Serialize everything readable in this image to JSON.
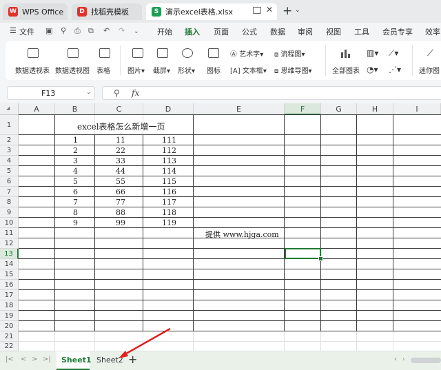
{
  "titlebar": {
    "tabs": [
      {
        "label": "WPS Office"
      },
      {
        "label": "找稻壳模板"
      },
      {
        "label": "演示excel表格.xlsx"
      }
    ]
  },
  "menu": {
    "file": "文件",
    "items": [
      "开始",
      "插入",
      "页面",
      "公式",
      "数据",
      "审阅",
      "视图",
      "工具",
      "会员专享",
      "效率"
    ],
    "active": "插入"
  },
  "ribbon": {
    "pivot_table": "数据透视表",
    "pivot_chart": "数据透视图",
    "table": "表格",
    "picture": "图片",
    "screenshot": "截屏",
    "shape": "形状",
    "icon": "图标",
    "art_text": "艺术字",
    "textbox": "文本框",
    "flowchart": "流程图",
    "mindmap": "思维导图",
    "all_charts": "全部图表",
    "sparkline": "迷你图"
  },
  "formula_bar": {
    "name_box": "F13",
    "fx": "fx",
    "formula": ""
  },
  "sheet": {
    "columns": [
      "A",
      "B",
      "C",
      "D",
      "E",
      "F",
      "G",
      "H",
      "I"
    ],
    "rows": [
      "1",
      "2",
      "3",
      "4",
      "5",
      "6",
      "7",
      "8",
      "9",
      "10",
      "11",
      "12",
      "13",
      "14",
      "15",
      "16",
      "17",
      "18",
      "19",
      "20",
      "21",
      "22"
    ],
    "title_text": "excel表格怎么新增一页",
    "data": [
      [
        "1",
        "11",
        "111"
      ],
      [
        "2",
        "22",
        "112"
      ],
      [
        "3",
        "33",
        "113"
      ],
      [
        "4",
        "44",
        "114"
      ],
      [
        "5",
        "55",
        "115"
      ],
      [
        "6",
        "66",
        "116"
      ],
      [
        "7",
        "77",
        "117"
      ],
      [
        "8",
        "88",
        "118"
      ],
      [
        "9",
        "99",
        "119"
      ]
    ],
    "note": "提供 www.hjga.com",
    "selected_cell": "F13"
  },
  "sheet_tabs": {
    "tabs": [
      "Sheet1",
      "Sheet2"
    ],
    "active": "Sheet1",
    "add": "+"
  },
  "colors": {
    "accent_green": "#1e7b34",
    "wps_red": "#e0332c",
    "doc_green": "#1f9d55",
    "selection": "#1e7b34",
    "arrow": "#e02020"
  }
}
